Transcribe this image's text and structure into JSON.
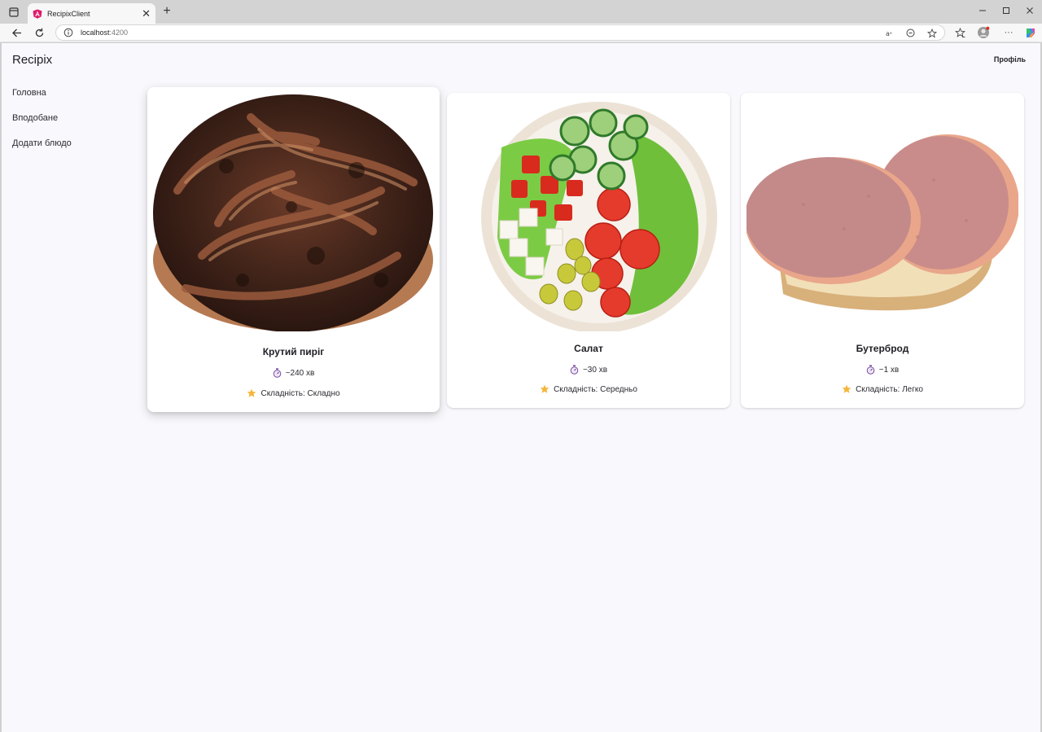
{
  "browser": {
    "tab_title": "RecipixClient",
    "url_host": "localhost",
    "url_port": ":4200"
  },
  "app": {
    "brand": "Recipix",
    "profile_label": "Профіль"
  },
  "sidebar": {
    "items": [
      {
        "label": "Головна"
      },
      {
        "label": "Вподобане"
      },
      {
        "label": "Додати блюдо"
      }
    ]
  },
  "recipes": [
    {
      "title": "Крутий пиріг",
      "time": "~240 хв",
      "difficulty": "Складність: Складно",
      "image": "braided-pastry"
    },
    {
      "title": "Салат",
      "time": "~30 хв",
      "difficulty": "Складність: Середньо",
      "image": "salad-bowl"
    },
    {
      "title": "Бутерброд",
      "time": "~1 хв",
      "difficulty": "Складність: Легко",
      "image": "sausage-sandwich"
    }
  ],
  "colors": {
    "page_bg": "#f9f8fc",
    "card_bg": "#ffffff",
    "star": "#f4b63a",
    "timer": "#7a4fa0"
  }
}
